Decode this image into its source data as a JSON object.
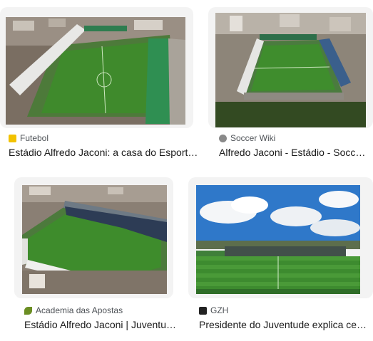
{
  "results": [
    {
      "source": "Futebol",
      "title": "Estádio Alfredo Jaconi: a casa do Esporte Clube Juventude",
      "favicon": "soccer-ball-icon",
      "favicon_color": "#f2c200"
    },
    {
      "source": "Soccer Wiki",
      "title": "Alfredo Jaconi - Estádio - Soccer Wiki",
      "favicon": "soccer-wiki-icon",
      "favicon_color": "#8a8a8a"
    },
    {
      "source": "Academia das Apostas",
      "title": "Estádio Alfredo Jaconi | Juventude",
      "favicon": "academia-leaf-icon",
      "favicon_color": "#6b8e23"
    },
    {
      "source": "GZH",
      "title": "Presidente do Juventude explica cenário do estádio",
      "favicon": "gzh-logo-icon",
      "favicon_color": "#222222"
    }
  ]
}
